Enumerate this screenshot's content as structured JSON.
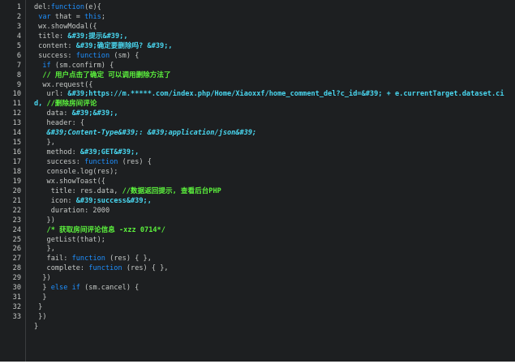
{
  "editor": {
    "colors": {
      "background": "#1d1f21",
      "text": "#c5c8c6",
      "keyword": "#1e90ff",
      "comment": "#5cf23d",
      "string": "#49d7f0"
    },
    "lines": [
      {
        "n": "1",
        "segs": [
          {
            "t": "del:",
            "c": "pl"
          },
          {
            "t": "function",
            "c": "kw"
          },
          {
            "t": "(e){",
            "c": "pl"
          }
        ]
      },
      {
        "n": "2",
        "segs": [
          {
            "t": " ",
            "c": "pl"
          },
          {
            "t": "var",
            "c": "kw"
          },
          {
            "t": " that = ",
            "c": "pl"
          },
          {
            "t": "this",
            "c": "kw"
          },
          {
            "t": ";",
            "c": "pl"
          }
        ]
      },
      {
        "n": "3",
        "segs": [
          {
            "t": " wx.showModal({",
            "c": "pl"
          }
        ]
      },
      {
        "n": "4",
        "segs": [
          {
            "t": " title: ",
            "c": "pl"
          },
          {
            "t": "&#39;提示&#39;,",
            "c": "st"
          }
        ]
      },
      {
        "n": "5",
        "segs": [
          {
            "t": " content: ",
            "c": "pl"
          },
          {
            "t": "&#39;确定要删除吗? &#39;,",
            "c": "st"
          }
        ]
      },
      {
        "n": "6",
        "segs": [
          {
            "t": " success: ",
            "c": "pl"
          },
          {
            "t": "function",
            "c": "kw"
          },
          {
            "t": " (sm) {",
            "c": "pl"
          }
        ]
      },
      {
        "n": "7",
        "segs": [
          {
            "t": "  ",
            "c": "pl"
          },
          {
            "t": "if",
            "c": "kw"
          },
          {
            "t": " (sm.confirm) {",
            "c": "pl"
          }
        ]
      },
      {
        "n": "8",
        "segs": [
          {
            "t": "  ",
            "c": "pl"
          },
          {
            "t": "// 用户点击了确定 可以调用删除方法了",
            "c": "cm"
          }
        ]
      },
      {
        "n": "9",
        "segs": [
          {
            "t": "  wx.request({",
            "c": "pl"
          }
        ]
      },
      {
        "n": "10",
        "segs": [
          {
            "t": "   url: ",
            "c": "pl"
          },
          {
            "t": "&#39;https://m.*****.com/index.php/Home/Xiaoxxf/home_comment_del?c_id=&#39; + e.currentTarget.dataset.ci",
            "c": "st"
          }
        ]
      },
      {
        "n": "11",
        "segs": [
          {
            "t": "d, ",
            "c": "st"
          },
          {
            "t": "//删除房间评论",
            "c": "cm"
          }
        ]
      },
      {
        "n": "12",
        "segs": [
          {
            "t": "   data: ",
            "c": "pl"
          },
          {
            "t": "&#39;&#39;,",
            "c": "st"
          }
        ]
      },
      {
        "n": "13",
        "segs": [
          {
            "t": "   header: {",
            "c": "pl"
          }
        ]
      },
      {
        "n": "14",
        "segs": [
          {
            "t": "   ",
            "c": "pl"
          },
          {
            "t": "&#39;Content-Type&#39;: &#39;application/json&#39;",
            "c": "stI"
          }
        ]
      },
      {
        "n": "15",
        "segs": [
          {
            "t": "   },",
            "c": "pl"
          }
        ]
      },
      {
        "n": "16",
        "segs": [
          {
            "t": "   method: ",
            "c": "pl"
          },
          {
            "t": "&#39;GET&#39;,",
            "c": "st"
          }
        ]
      },
      {
        "n": "17",
        "segs": [
          {
            "t": "   success: ",
            "c": "pl"
          },
          {
            "t": "function",
            "c": "kw"
          },
          {
            "t": " (res) {",
            "c": "pl"
          }
        ]
      },
      {
        "n": "18",
        "segs": [
          {
            "t": "   console.log(res);",
            "c": "pl"
          }
        ]
      },
      {
        "n": "19",
        "segs": [
          {
            "t": "   wx.showToast({",
            "c": "pl"
          }
        ]
      },
      {
        "n": "20",
        "segs": [
          {
            "t": "    title: res.data, ",
            "c": "pl"
          },
          {
            "t": "//数据返回提示, 查看后台PHP",
            "c": "cm"
          }
        ]
      },
      {
        "n": "21",
        "segs": [
          {
            "t": "    icon: ",
            "c": "pl"
          },
          {
            "t": "&#39;success&#39;,",
            "c": "st"
          }
        ]
      },
      {
        "n": "22",
        "segs": [
          {
            "t": "    duration: 2000",
            "c": "pl"
          }
        ]
      },
      {
        "n": "23",
        "segs": [
          {
            "t": "   })",
            "c": "pl"
          }
        ]
      },
      {
        "n": "24",
        "segs": [
          {
            "t": "   ",
            "c": "pl"
          },
          {
            "t": "/* 获取房间评论信息 -xzz 0714*/",
            "c": "cm"
          }
        ]
      },
      {
        "n": "25",
        "segs": [
          {
            "t": "   getList(that);",
            "c": "pl"
          }
        ]
      },
      {
        "n": "26",
        "segs": [
          {
            "t": "   },",
            "c": "pl"
          }
        ]
      },
      {
        "n": "27",
        "segs": [
          {
            "t": "   fail: ",
            "c": "pl"
          },
          {
            "t": "function",
            "c": "kw"
          },
          {
            "t": " (res) { },",
            "c": "pl"
          }
        ]
      },
      {
        "n": "28",
        "segs": [
          {
            "t": "   complete: ",
            "c": "pl"
          },
          {
            "t": "function",
            "c": "kw"
          },
          {
            "t": " (res) { },",
            "c": "pl"
          }
        ]
      },
      {
        "n": "29",
        "segs": [
          {
            "t": "  })",
            "c": "pl"
          }
        ]
      },
      {
        "n": "30",
        "segs": [
          {
            "t": "  } ",
            "c": "pl"
          },
          {
            "t": "else if",
            "c": "kw"
          },
          {
            "t": " (sm.cancel) {",
            "c": "pl"
          }
        ]
      },
      {
        "n": "31",
        "segs": [
          {
            "t": "  }",
            "c": "pl"
          }
        ]
      },
      {
        "n": "32",
        "segs": [
          {
            "t": " }",
            "c": "pl"
          }
        ]
      },
      {
        "n": "33",
        "segs": [
          {
            "t": " })",
            "c": "pl"
          }
        ]
      },
      {
        "n": "",
        "segs": [
          {
            "t": "}",
            "c": "pl"
          }
        ]
      }
    ]
  }
}
